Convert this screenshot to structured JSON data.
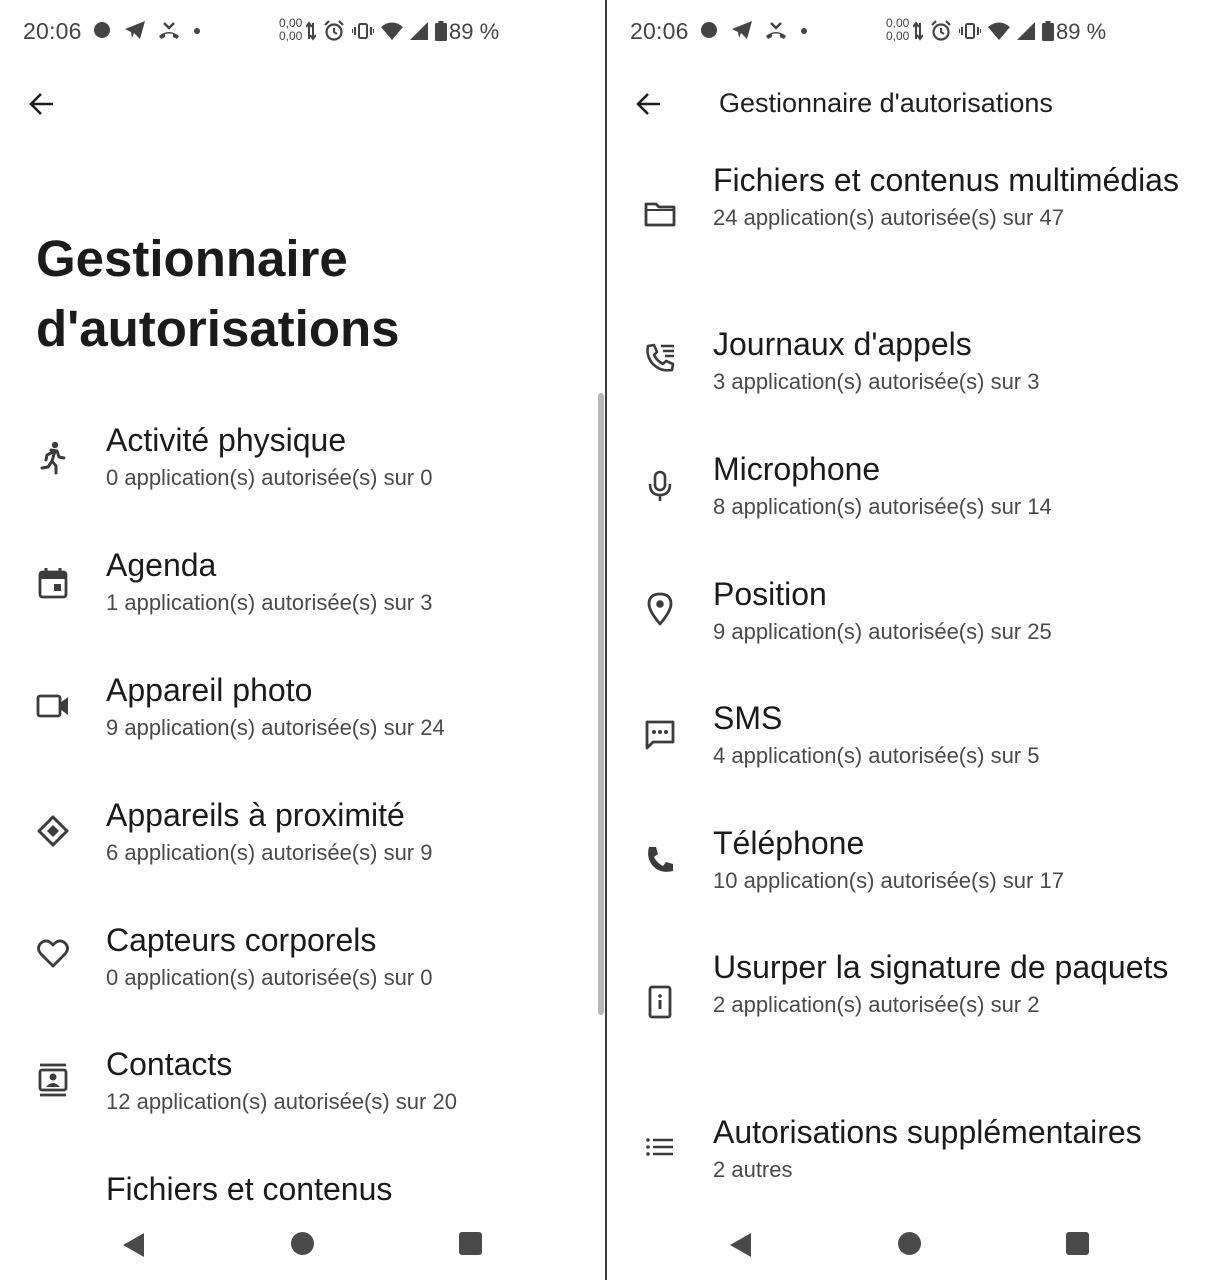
{
  "status_bar": {
    "time": "20:06",
    "net_up": "0,00",
    "net_down": "0,00",
    "battery": "89 %"
  },
  "left": {
    "page_title": "Gestionnaire d'autorisations",
    "items": [
      {
        "title": "Activité physique",
        "subtitle": "0 application(s) autorisée(s) sur 0",
        "icon": "walking-icon"
      },
      {
        "title": "Agenda",
        "subtitle": "1 application(s) autorisée(s) sur 3",
        "icon": "calendar-icon"
      },
      {
        "title": "Appareil photo",
        "subtitle": "9 application(s) autorisée(s) sur 24",
        "icon": "camera-icon"
      },
      {
        "title": "Appareils à proximité",
        "subtitle": "6 application(s) autorisée(s) sur 9",
        "icon": "nearby-icon"
      },
      {
        "title": "Capteurs corporels",
        "subtitle": "0 application(s) autorisée(s) sur 0",
        "icon": "heart-icon"
      },
      {
        "title": "Contacts",
        "subtitle": "12 application(s) autorisée(s) sur 20",
        "icon": "contacts-icon"
      },
      {
        "title": "Fichiers et contenus",
        "subtitle": "",
        "icon": "folder-icon"
      }
    ]
  },
  "right": {
    "toolbar_title": "Gestionnaire d'autorisations",
    "items": [
      {
        "title": "Fichiers et contenus multimédias",
        "subtitle": "24 application(s) autorisée(s) sur 47",
        "icon": "folder-icon"
      },
      {
        "title": "Journaux d'appels",
        "subtitle": "3 application(s) autorisée(s) sur 3",
        "icon": "call-log-icon"
      },
      {
        "title": "Microphone",
        "subtitle": "8 application(s) autorisée(s) sur 14",
        "icon": "microphone-icon"
      },
      {
        "title": "Position",
        "subtitle": "9 application(s) autorisée(s) sur 25",
        "icon": "location-pin-icon"
      },
      {
        "title": "SMS",
        "subtitle": "4 application(s) autorisée(s) sur 5",
        "icon": "sms-icon"
      },
      {
        "title": "Téléphone",
        "subtitle": "10 application(s) autorisée(s) sur 17",
        "icon": "phone-icon"
      },
      {
        "title": "Usurper la signature de paquets",
        "subtitle": "2 application(s) autorisée(s) sur 2",
        "icon": "package-signature-icon"
      },
      {
        "title": "Autorisations supplémentaires",
        "subtitle": "2 autres",
        "icon": "list-icon"
      }
    ]
  }
}
